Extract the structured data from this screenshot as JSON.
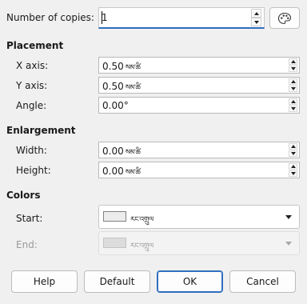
{
  "copies": {
    "label": "Number of copies:",
    "value": "1"
  },
  "palette_button": {
    "icon": "palette-icon"
  },
  "placement": {
    "heading": "Placement",
    "x": {
      "label": "X axis:",
      "value": "0.50",
      "unit": "སམ་ཚི"
    },
    "y": {
      "label": "Y axis:",
      "value": "0.50",
      "unit": "སམ་ཚི"
    },
    "angle": {
      "label": "Angle:",
      "value": "0.00°"
    }
  },
  "enlargement": {
    "heading": "Enlargement",
    "width": {
      "label": "Width:",
      "value": "0.00",
      "unit": "སམ་ཚི"
    },
    "height": {
      "label": "Height:",
      "value": "0.00",
      "unit": "སམ་ཚི"
    }
  },
  "colors": {
    "heading": "Colors",
    "start": {
      "label": "Start:",
      "color_name": "རང་འགྲུལ",
      "swatch": "#ececec"
    },
    "end": {
      "label": "End:",
      "color_name": "རང་འགྲུལ",
      "swatch": "#dcdcdc"
    }
  },
  "buttons": {
    "help": "Help",
    "default": "Default",
    "ok": "OK",
    "cancel": "Cancel"
  },
  "colors_ui": {
    "accent": "#2f6fbf",
    "background": "#f0f0f0"
  }
}
